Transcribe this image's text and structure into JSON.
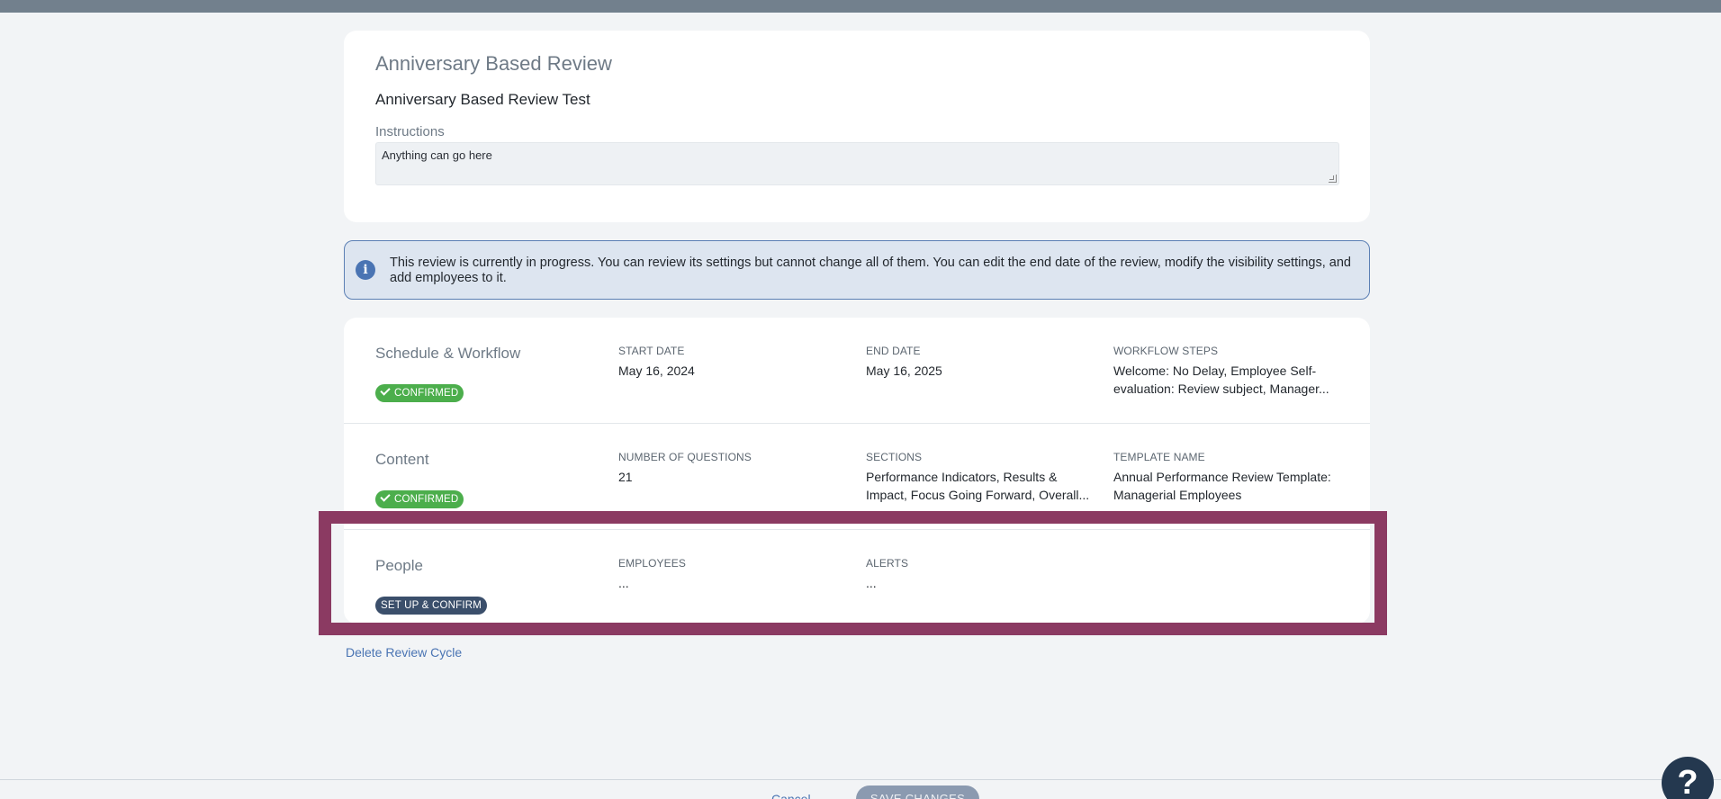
{
  "review": {
    "title": "Anniversary Based Review",
    "name": "Anniversary Based Review Test",
    "instructions_label": "Instructions",
    "instructions_value": "Anything can go here"
  },
  "info_banner": {
    "icon": "info-icon",
    "text": "This review is currently in progress. You can review its settings but cannot change all of them. You can edit the end date of the review, modify the visibility settings, and add employees to it."
  },
  "sections": {
    "schedule": {
      "title": "Schedule & Workflow",
      "badge": "CONFIRMED",
      "start_label": "START DATE",
      "start_value": "May 16, 2024",
      "end_label": "END DATE",
      "end_value": "May 16, 2025",
      "workflow_label": "WORKFLOW STEPS",
      "workflow_value": "Welcome: No Delay, Employee Self-evaluation: Review subject, Manager..."
    },
    "content": {
      "title": "Content",
      "badge": "CONFIRMED",
      "questions_label": "NUMBER OF QUESTIONS",
      "questions_value": "21",
      "sections_label": "SECTIONS",
      "sections_value": "Performance Indicators, Results & Impact, Focus Going Forward, Overall...",
      "template_label": "TEMPLATE NAME",
      "template_value": "Annual Performance Review Template: Managerial Employees"
    },
    "people": {
      "title": "People",
      "badge": "SET UP & CONFIRM",
      "employees_label": "EMPLOYEES",
      "employees_value": "...",
      "alerts_label": "ALERTS",
      "alerts_value": "..."
    }
  },
  "actions": {
    "delete": "Delete Review Cycle",
    "cancel": "Cancel",
    "save": "SAVE CHANGES",
    "help": "?"
  },
  "colors": {
    "highlight": "#8b3a62",
    "confirmed": "#4cae4c",
    "setup": "#3b4f6b",
    "link": "#4a74b3"
  }
}
